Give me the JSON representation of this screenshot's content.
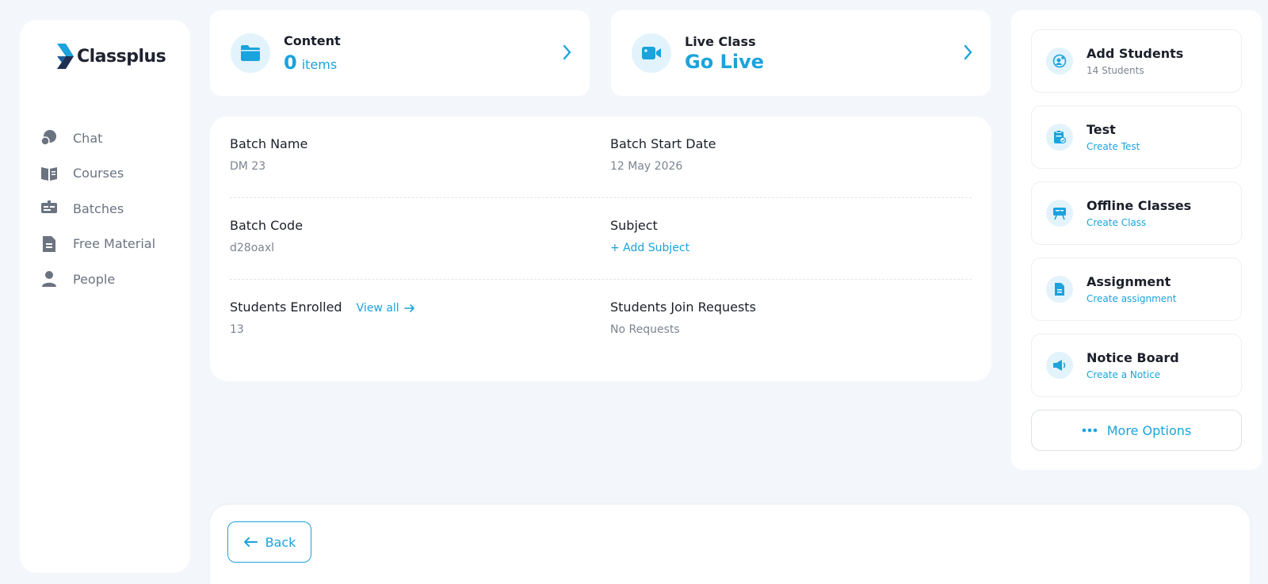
{
  "brand": {
    "name": "Classplus"
  },
  "sidebar": {
    "items": [
      {
        "label": "Chat",
        "icon": "chat-icon"
      },
      {
        "label": "Courses",
        "icon": "book-icon"
      },
      {
        "label": "Batches",
        "icon": "batches-icon"
      },
      {
        "label": "Free Material",
        "icon": "document-icon"
      },
      {
        "label": "People",
        "icon": "person-icon"
      }
    ]
  },
  "content_card": {
    "title": "Content",
    "count": "0",
    "unit": "items"
  },
  "live_card": {
    "title": "Live Class",
    "action": "Go Live"
  },
  "details": {
    "batch_name": {
      "label": "Batch Name",
      "value": "DM 23"
    },
    "batch_start_date": {
      "label": "Batch Start Date",
      "value": "12 May 2026"
    },
    "batch_code": {
      "label": "Batch Code",
      "value": "d28oaxl"
    },
    "subject": {
      "label": "Subject",
      "action": "+ Add Subject"
    },
    "students_enrolled": {
      "label": "Students Enrolled",
      "view_all": "View all",
      "value": "13"
    },
    "join_requests": {
      "label": "Students Join Requests",
      "value": "No Requests"
    }
  },
  "actions": [
    {
      "title": "Add Students",
      "subtitle": "14 Students",
      "icon": "add-student-icon"
    },
    {
      "title": "Test",
      "subtitle": "Create Test",
      "icon": "clipboard-icon"
    },
    {
      "title": "Offline Classes",
      "subtitle": "Create Class",
      "icon": "board-icon"
    },
    {
      "title": "Assignment",
      "subtitle": "Create assignment",
      "icon": "assignment-icon"
    },
    {
      "title": "Notice Board",
      "subtitle": "Create a Notice",
      "icon": "megaphone-icon"
    }
  ],
  "more_options": {
    "label": "More Options"
  },
  "back": {
    "label": "Back"
  },
  "colors": {
    "accent": "#1aa3dd",
    "muted": "#7c8490",
    "background": "#f3f7fb",
    "icon_bg": "#e3f3fb",
    "sidebar_icon": "#6b7380"
  }
}
